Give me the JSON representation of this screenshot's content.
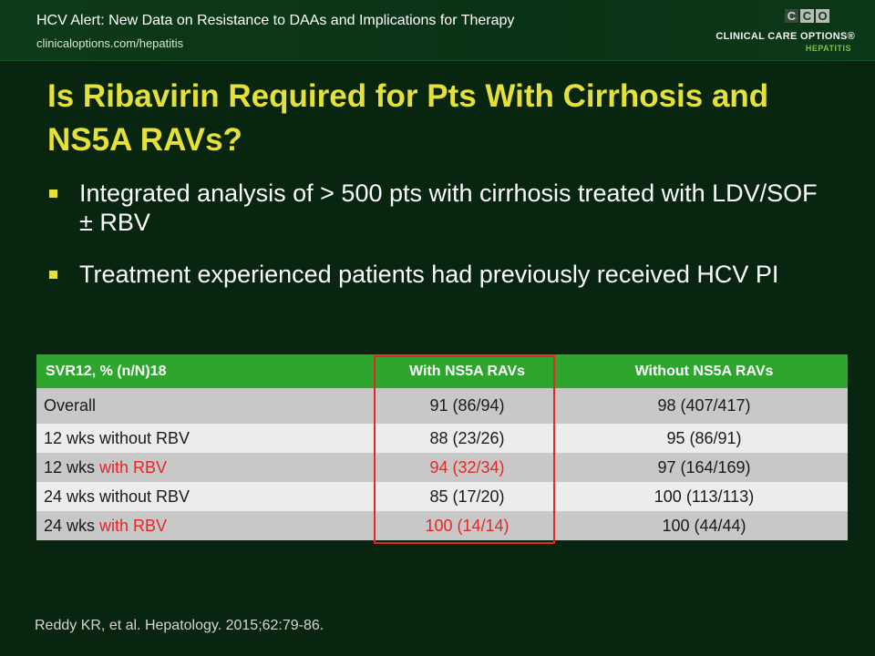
{
  "header": {
    "title": "HCV Alert: New Data on Resistance to DAAs and Implications for Therapy",
    "url": "clinicaloptions.com/hepatitis"
  },
  "logo": {
    "letters": [
      "C",
      "C",
      "O"
    ],
    "name": "CLINICAL CARE OPTIONS®",
    "subtitle": "HEPATITIS"
  },
  "slide": {
    "title": "Is Ribavirin Required for Pts With Cirrhosis and NS5A RAVs?",
    "bullets": [
      "Integrated analysis of > 500 pts with cirrhosis treated with LDV/SOF ± RBV",
      "Treatment experienced patients had previously received HCV PI"
    ]
  },
  "table": {
    "headers": [
      "SVR12, % (n/N)18",
      "With NS5A RAVs",
      "Without NS5A RAVs"
    ],
    "rows": [
      {
        "label_main": "Overall",
        "label_red": "",
        "with": "91 (86/94)",
        "without": "98 (407/417)"
      },
      {
        "label_main": "12 wks without RBV",
        "label_red": "",
        "with": "88 (23/26)",
        "without": "95 (86/91)"
      },
      {
        "label_main": "12 wks ",
        "label_red": "with RBV",
        "with": "94 (32/34)",
        "without": "97 (164/169)"
      },
      {
        "label_main": "24 wks without RBV",
        "label_red": "",
        "with": "85 (17/20)",
        "without": "100 (113/113)"
      },
      {
        "label_main": "24 wks ",
        "label_red": "with RBV",
        "with": "100 (14/14)",
        "without": "100 (44/44)"
      }
    ]
  },
  "citation": "Reddy KR, et al. Hepatology. 2015;62:79-86.",
  "colors": {
    "background": "#07250f",
    "title": "#e6e03a",
    "table_header": "#2ea62e",
    "highlight": "#e32626"
  }
}
